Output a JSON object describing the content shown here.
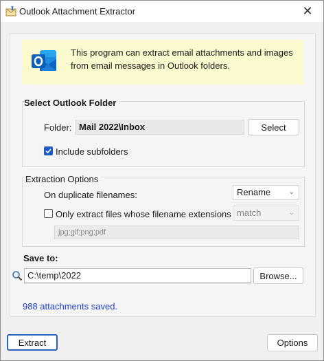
{
  "window": {
    "title": "Outlook Attachment Extractor",
    "close_glyph": "✕"
  },
  "info": {
    "icon": "outlook-icon",
    "text": "This program can extract email attachments and images from email messages in Outlook folders."
  },
  "folder_group": {
    "title": "Select Outlook Folder",
    "folder_label": "Folder:",
    "folder_value": "Mail 2022\\Inbox",
    "select_button": "Select",
    "include_subfolders_label": "Include subfolders",
    "include_subfolders_checked": true
  },
  "extraction_group": {
    "title": "Extraction Options",
    "duplicate_label": "On duplicate filenames:",
    "duplicate_value": "Rename",
    "only_extract_label": "Only extract files whose filename extensions",
    "only_extract_checked": false,
    "match_value": "match",
    "extensions_value": "jpg;gif;png;pdf"
  },
  "save": {
    "label": "Save to:",
    "path": "C:\\temp\\2022",
    "browse_button": "Browse..."
  },
  "status": "988 attachments saved.",
  "buttons": {
    "extract": "Extract",
    "options": "Options"
  },
  "colors": {
    "info_bg": "#fbfacf",
    "status_text": "#1c3fc2",
    "checkbox_checked": "#1e5cbf",
    "default_button_border": "#2b63b8"
  }
}
